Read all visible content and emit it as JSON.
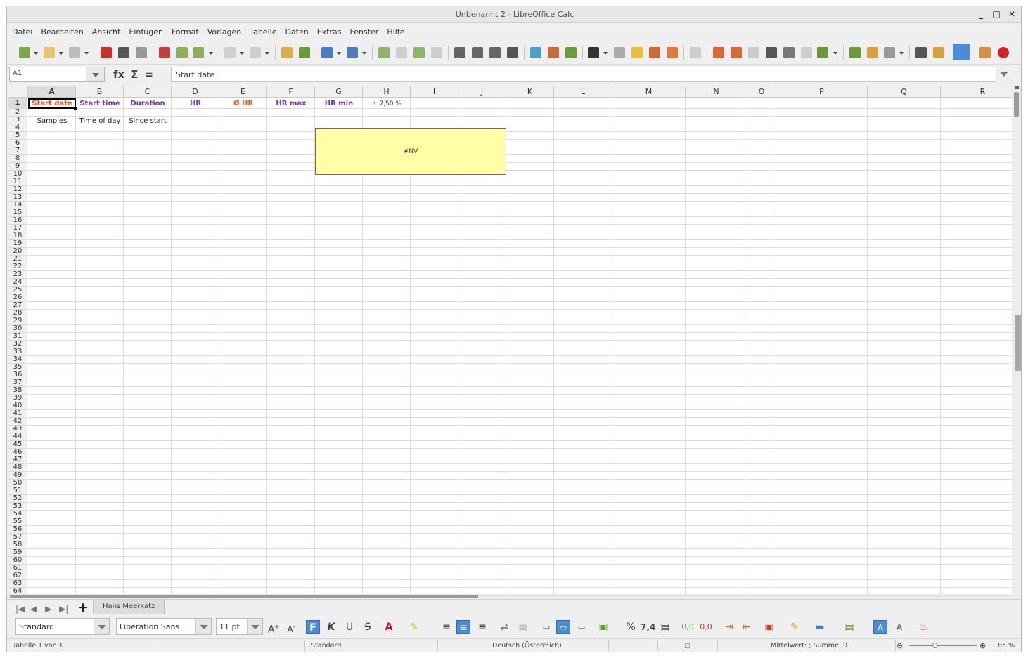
{
  "window": {
    "title": "Unbenannt 2 - LibreOffice Calc",
    "min": "_",
    "max": "□",
    "close": "✕"
  },
  "menu": [
    "Datei",
    "Bearbeiten",
    "Ansicht",
    "Einfügen",
    "Format",
    "Vorlagen",
    "Tabelle",
    "Daten",
    "Extras",
    "Fenster",
    "Hilfe"
  ],
  "formula_bar": {
    "cell_ref": "A1",
    "fx": "fx",
    "sum": "Σ",
    "eq": "=",
    "content": "Start date"
  },
  "columns": [
    "A",
    "B",
    "C",
    "D",
    "E",
    "F",
    "G",
    "H",
    "I",
    "J",
    "K",
    "L",
    "M",
    "N",
    "O",
    "P",
    "Q",
    "R"
  ],
  "rows_visible": 64,
  "cells": {
    "A1": "Start date",
    "B1": "Start time",
    "C1": "Duration",
    "D1": "HR",
    "E1": "Ø HR",
    "F1": "HR max",
    "G1": "HR min",
    "H1": "± 7,50  %",
    "A3": "Samples",
    "B3": "Time of day",
    "C3": "Since start"
  },
  "colors": {
    "orange": "#e8541a",
    "purple": "#6a3aa8",
    "note_bg": "#ffffa6",
    "active_blue": "#4b8bd7"
  },
  "note_text": "#NV",
  "sheet_tabs": {
    "active": "Hans Meerkatz",
    "add": "+"
  },
  "format_bar": {
    "style": "Standard",
    "font": "Liberation Sans",
    "size": "11 pt",
    "bold": "F",
    "italic": "K",
    "underline": "U",
    "strike": "S",
    "percent": "%",
    "decimal": "7,4"
  },
  "status": {
    "sheet": "Tabelle 1 von 1",
    "page_style": "Standard",
    "language": "Deutsch (Österreich)",
    "summary": "Mittelwert: ; Summe: 0",
    "zoom": "85 %"
  }
}
